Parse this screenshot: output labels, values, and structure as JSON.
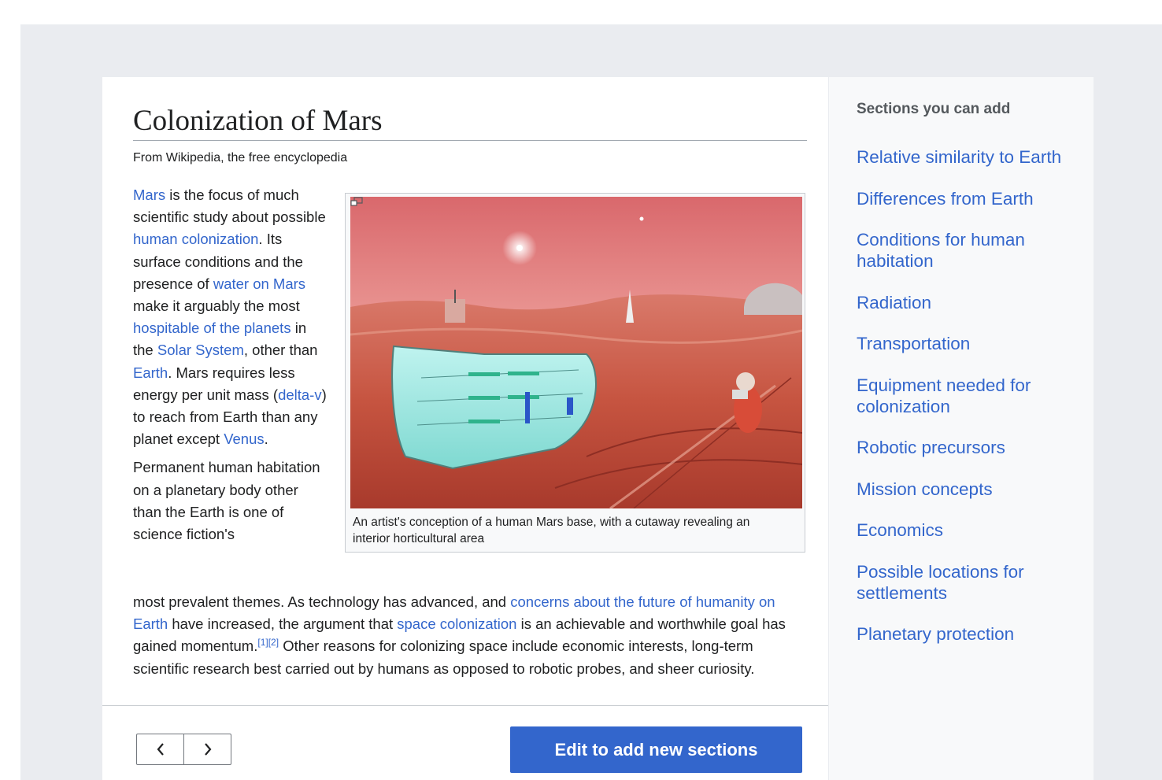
{
  "article": {
    "title": "Colonization of Mars",
    "tagline": "From Wikipedia, the free encyclopedia",
    "p1": {
      "mars": "Mars",
      "t1": " is the focus of much scientific study about possible ",
      "human_colonization": "human colonization",
      "t2": ". Its surface conditions and the presence of ",
      "water_on_mars": "water on Mars",
      "t3": " make it arguably the most ",
      "hospitable": "hospitable of the planets",
      "t4": " in the ",
      "solar_system": "Solar System",
      "t5": ", other than ",
      "earth": "Earth",
      "t6": ". Mars requires less energy per unit mass (",
      "delta_v": "delta-v",
      "t7": ") to reach from Earth than any planet except ",
      "venus": "Venus",
      "t8": "."
    },
    "p2": {
      "t1": "Permanent human habitation on a planetary body other than the Earth is one of science fiction's",
      "t2": "most prevalent themes. As technology has advanced, and ",
      "concerns": "concerns about the future of humanity on Earth",
      "t3": " have increased, the argument that ",
      "space_colonization": "space colonization",
      "t4": " is an achievable and worthwhile goal has gained momentum.",
      "ref1": "[1]",
      "ref2": "[2]",
      "t5": " Other reasons for colonizing space include economic interests, long-term scientific research best carried out by humans as opposed to robotic probes, and sheer curiosity."
    },
    "image_caption": "An artist's conception of a human Mars base, with a cutaway revealing an interior horticultural area"
  },
  "footer": {
    "prev_icon": "chevron-left-icon",
    "next_icon": "chevron-right-icon",
    "edit_button": "Edit to add new sections"
  },
  "sidebar": {
    "heading": "Sections you can add",
    "items": [
      "Relative similarity to Earth",
      "Differences from Earth",
      "Conditions for human habitation",
      "Radiation",
      "Transportation",
      "Equipment needed for colonization",
      "Robotic precursors",
      "Mission concepts",
      "Economics",
      "Possible locations for settlements",
      "Planetary protection"
    ]
  },
  "colors": {
    "link": "#3366cc",
    "primary_button": "#3366cc",
    "backdrop": "#eaecf0",
    "sidebar_bg": "#f8f9fa"
  }
}
